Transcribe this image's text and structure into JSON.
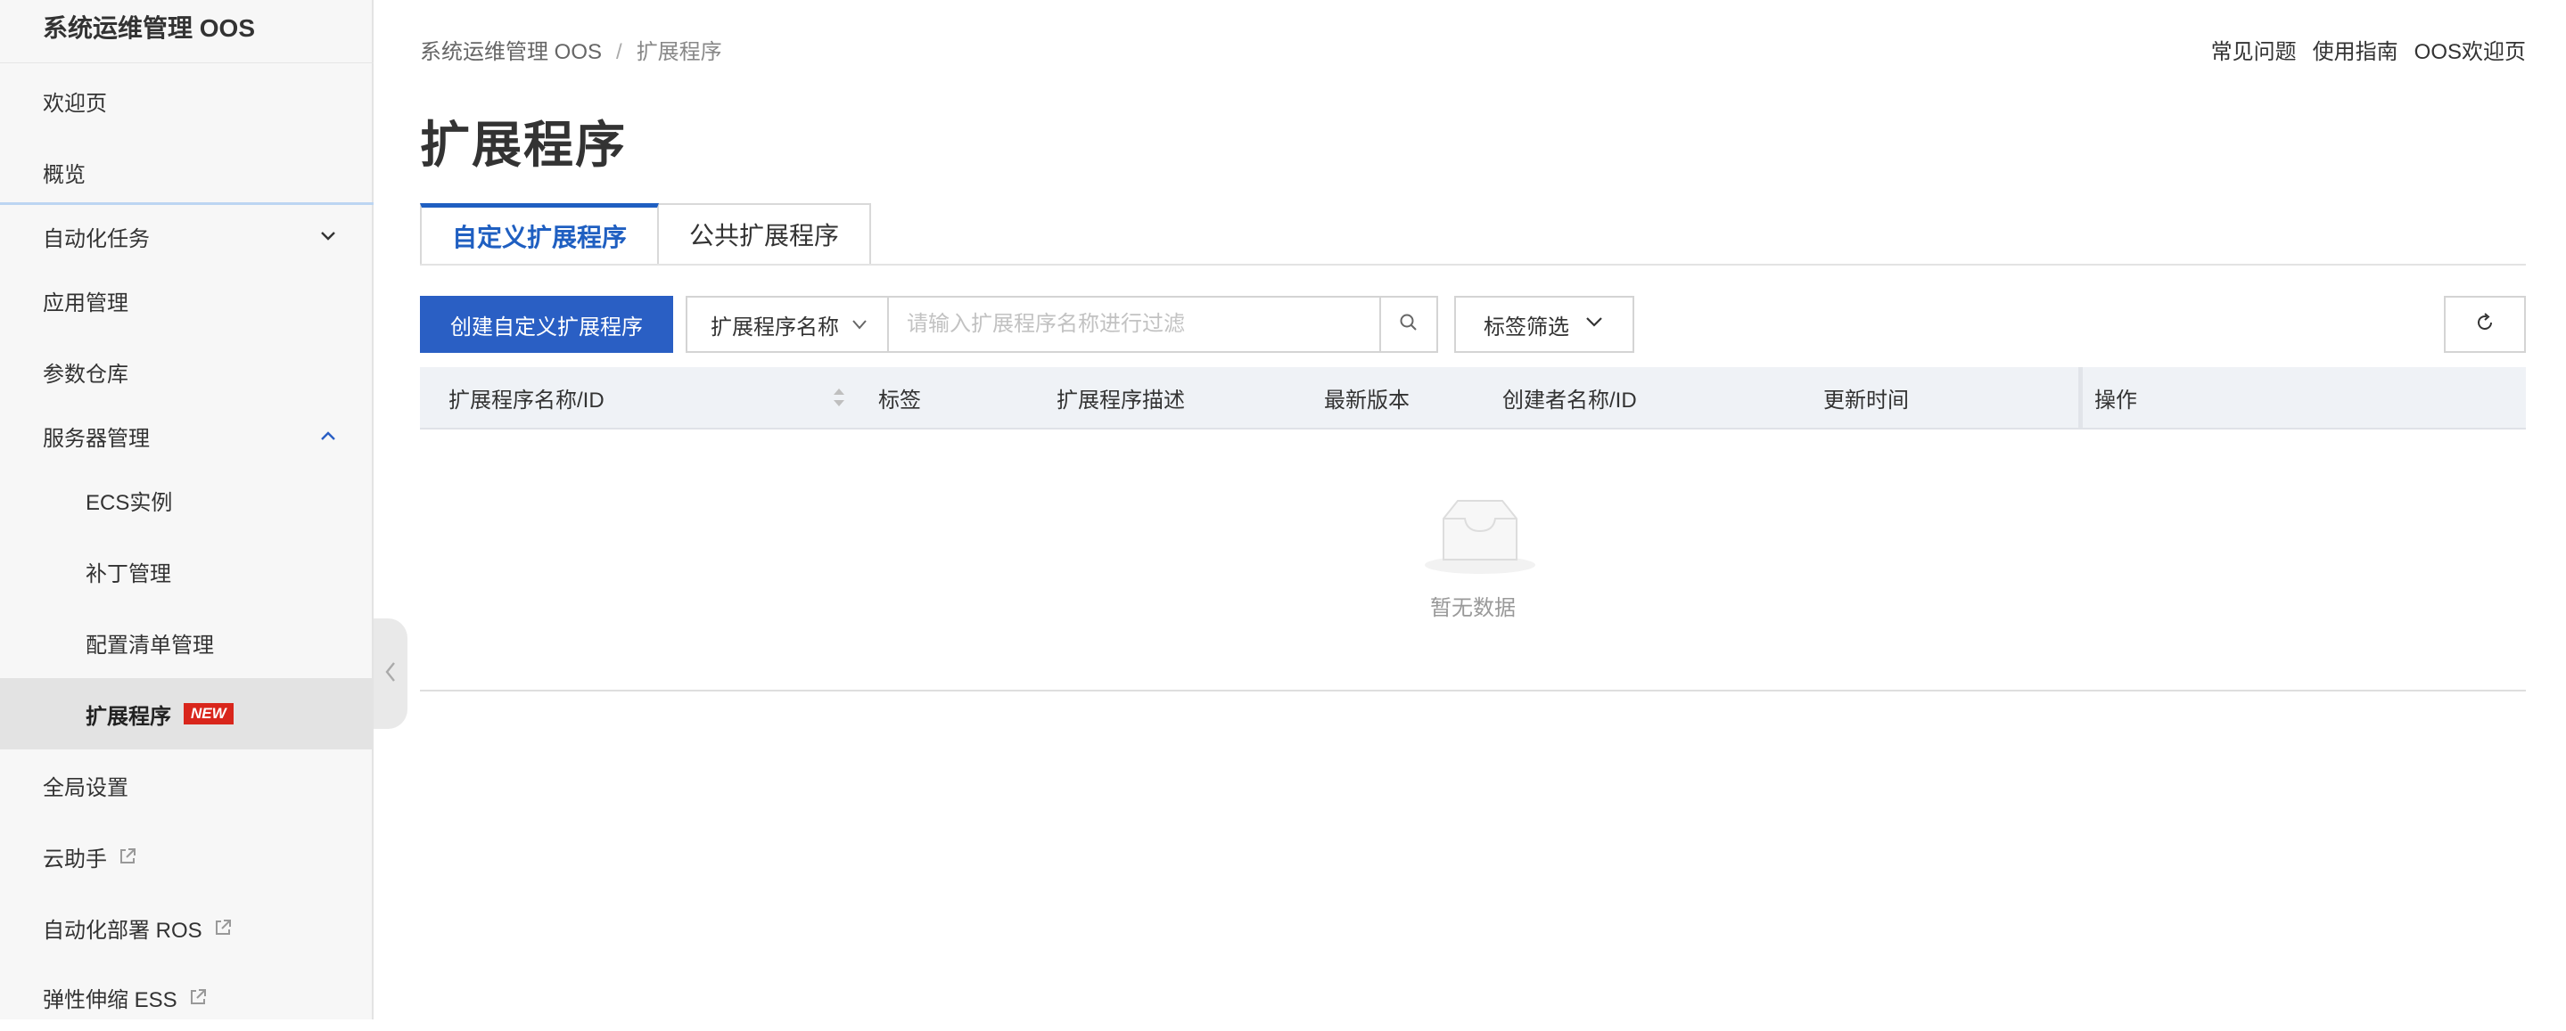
{
  "sidebar": {
    "brand": "系统运维管理 OOS",
    "items": [
      {
        "label": "欢迎页"
      },
      {
        "label": "概览"
      },
      {
        "label": "自动化任务"
      },
      {
        "label": "应用管理"
      },
      {
        "label": "参数仓库"
      },
      {
        "label": "服务器管理"
      },
      {
        "label": "ECS实例"
      },
      {
        "label": "补丁管理"
      },
      {
        "label": "配置清单管理"
      },
      {
        "label": "扩展程序",
        "badge": "NEW"
      },
      {
        "label": "全局设置"
      },
      {
        "label": "云助手"
      },
      {
        "label": "自动化部署 ROS"
      },
      {
        "label": "弹性伸缩 ESS"
      }
    ]
  },
  "breadcrumb": {
    "root": "系统运维管理 OOS",
    "separator": "/",
    "current": "扩展程序"
  },
  "top_links": {
    "faq": "常见问题",
    "guide": "使用指南",
    "welcome": "OOS欢迎页"
  },
  "page_title": "扩展程序",
  "tabs": {
    "custom": "自定义扩展程序",
    "public": "公共扩展程序"
  },
  "toolbar": {
    "create_label": "创建自定义扩展程序",
    "filter_select": "扩展程序名称",
    "search_placeholder": "请输入扩展程序名称进行过滤",
    "tag_filter": "标签筛选"
  },
  "table": {
    "columns": [
      "扩展程序名称/ID",
      "标签",
      "扩展程序描述",
      "最新版本",
      "创建者名称/ID",
      "更新时间",
      "操作"
    ],
    "empty_text": "暂无数据"
  },
  "colors": {
    "primary": "#2a5fc4",
    "active_tab": "#1f5fc1",
    "badge": "#d9261c"
  }
}
